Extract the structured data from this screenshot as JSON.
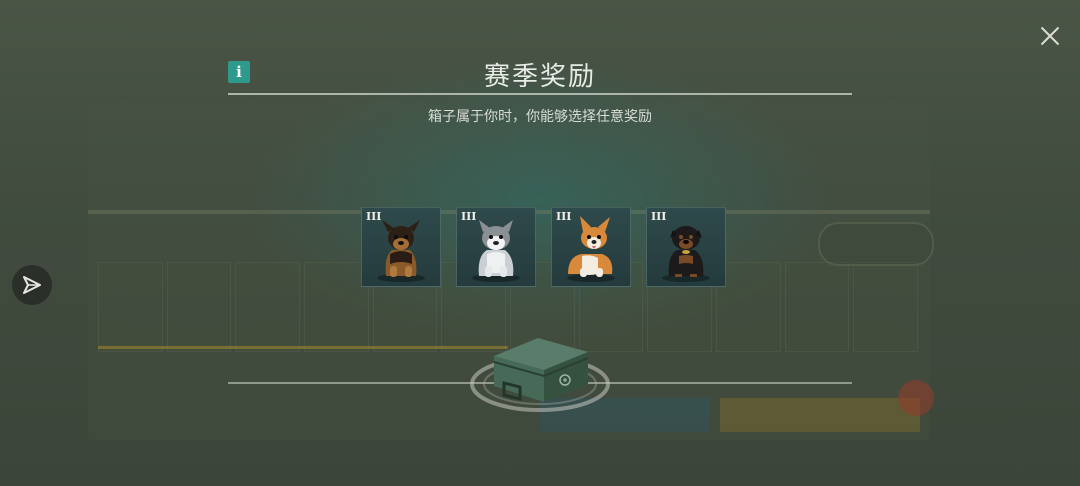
{
  "modal": {
    "title": "赛季奖励",
    "subtitle": "箱子属于你时，你能够选择任意奖励",
    "info_label": "i",
    "rewards": [
      {
        "tier": "III",
        "name": "german-shepherd-puppy"
      },
      {
        "tier": "III",
        "name": "husky-puppy"
      },
      {
        "tier": "III",
        "name": "corgi-puppy"
      },
      {
        "tier": "III",
        "name": "rottweiler-puppy"
      }
    ]
  },
  "icons": {
    "close": "close-icon",
    "info": "info-icon",
    "side": "send-arrow-icon",
    "chest": "reward-chest-icon"
  },
  "colors": {
    "accent_teal": "#2e9a8c",
    "title_text": "#e8ece6",
    "tile_bg": "#2f4a4c"
  }
}
